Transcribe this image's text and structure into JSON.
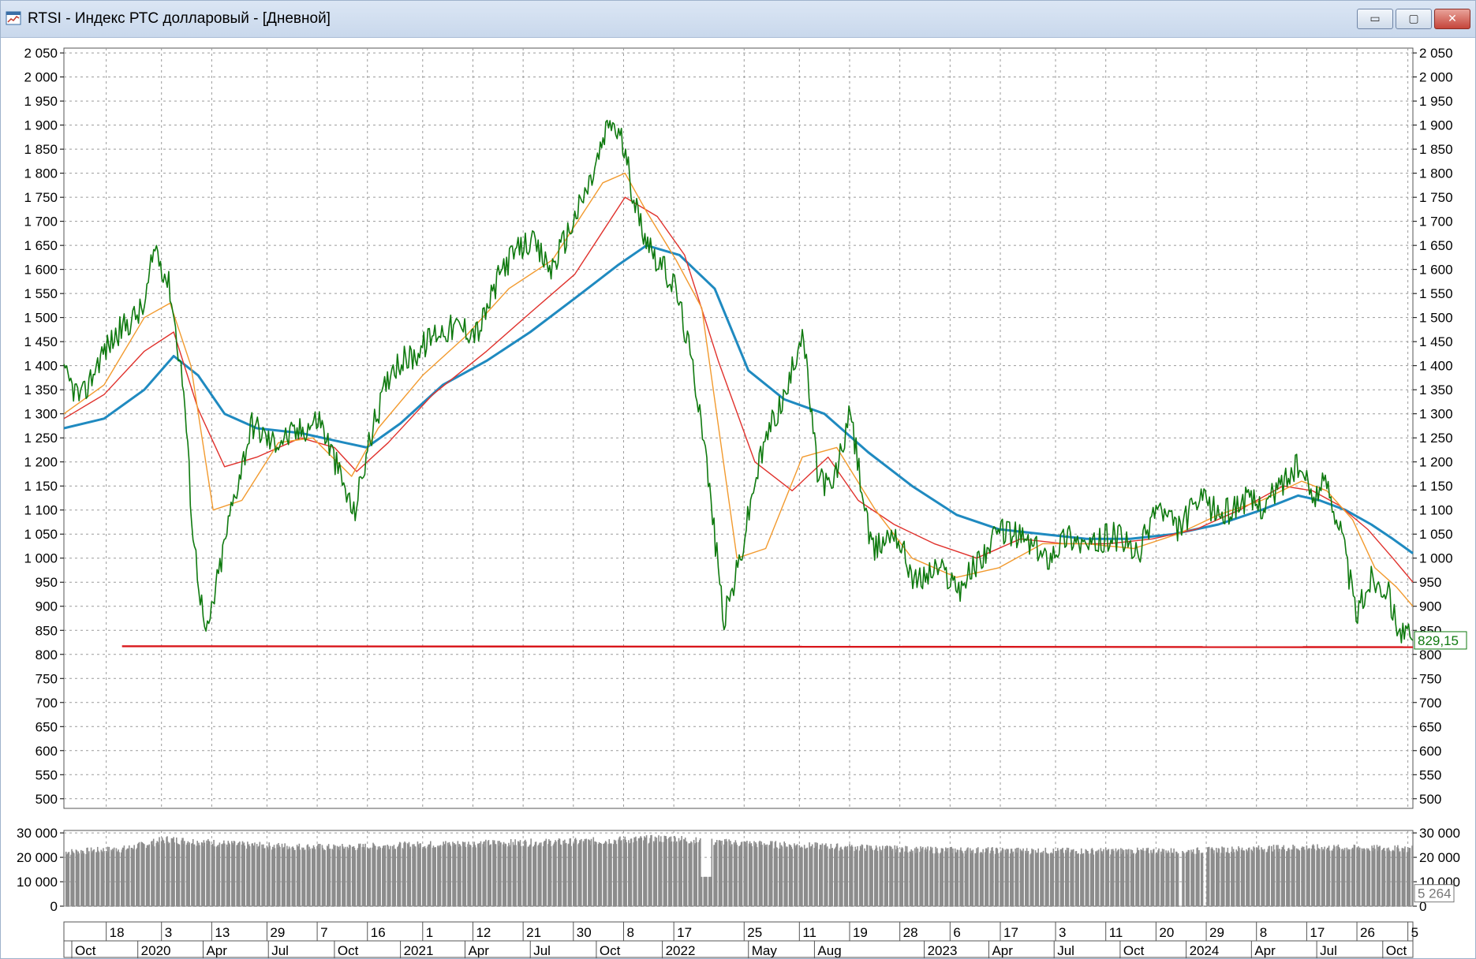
{
  "window": {
    "title": "RTSI - Индекс РТС долларовый - [Дневной]",
    "minimize_glyph": "▭",
    "maximize_glyph": "▢",
    "close_glyph": "✕",
    "icon": "chart-window-icon"
  },
  "colors": {
    "price": "#0f7a0f",
    "ma_short": "#f29a2e",
    "ma_mid": "#e0312c",
    "ma_long": "#1f8ac0",
    "support": "#d9161b",
    "volume": "#8c8c8c",
    "grid": "#9a9a9a"
  },
  "chart_data": [
    {
      "type": "line",
      "y_ticks": [
        "2 050",
        "2 000",
        "1 950",
        "1 900",
        "1 850",
        "1 800",
        "1 750",
        "1 700",
        "1 650",
        "1 600",
        "1 550",
        "1 500",
        "1 450",
        "1 400",
        "1 350",
        "1 300",
        "1 250",
        "1 200",
        "1 150",
        "1 100",
        "1 050",
        "1 000",
        "950",
        "900",
        "850",
        "800",
        "750",
        "700",
        "650",
        "600",
        "550",
        "500"
      ],
      "ylim": [
        480,
        2060
      ],
      "xlim": [
        "2019-09-20",
        "2024-11-12"
      ],
      "last_value_label": "829,15",
      "grid": true,
      "series": [
        {
          "role": "price",
          "x": [
            "2019-09-20",
            "2019-10-15",
            "2019-11-10",
            "2019-12-05",
            "2020-01-10",
            "2020-01-25",
            "2020-02-15",
            "2020-03-05",
            "2020-03-18",
            "2020-04-05",
            "2020-05-10",
            "2020-06-08",
            "2020-07-05",
            "2020-08-10",
            "2020-09-10",
            "2020-10-02",
            "2020-10-28",
            "2020-11-20",
            "2020-12-20",
            "2021-01-20",
            "2021-02-20",
            "2021-03-20",
            "2021-04-20",
            "2021-05-25",
            "2021-06-30",
            "2021-07-30",
            "2021-08-30",
            "2021-09-25",
            "2021-10-20",
            "2021-11-05",
            "2021-11-30",
            "2021-12-25",
            "2022-01-20",
            "2022-02-05",
            "2022-02-24",
            "2022-03-28",
            "2022-04-20",
            "2022-05-10",
            "2022-05-30",
            "2022-06-25",
            "2022-07-15",
            "2022-08-05",
            "2022-08-25",
            "2022-09-20",
            "2022-10-20",
            "2022-11-20",
            "2022-12-20",
            "2023-01-20",
            "2023-02-20",
            "2023-03-20",
            "2023-04-20",
            "2023-05-20",
            "2023-06-20",
            "2023-07-20",
            "2023-08-20",
            "2023-09-20",
            "2023-10-10",
            "2023-10-25",
            "2023-11-20",
            "2023-12-20",
            "2024-01-20",
            "2024-02-20",
            "2024-03-20",
            "2024-04-20",
            "2024-05-15",
            "2024-06-05",
            "2024-06-25",
            "2024-07-15",
            "2024-08-05",
            "2024-08-25",
            "2024-09-15",
            "2024-10-05",
            "2024-10-25",
            "2024-11-12"
          ],
          "values": [
            1380,
            1330,
            1420,
            1470,
            1520,
            1650,
            1560,
            1350,
            1050,
            830,
            1100,
            1280,
            1240,
            1260,
            1290,
            1200,
            1090,
            1250,
            1400,
            1420,
            1470,
            1480,
            1470,
            1610,
            1660,
            1600,
            1700,
            1790,
            1910,
            1870,
            1700,
            1620,
            1560,
            1450,
            1300,
            870,
            1000,
            1160,
            1270,
            1350,
            1480,
            1180,
            1140,
            1300,
            1010,
            1060,
            950,
            980,
            940,
            1000,
            1060,
            1040,
            1000,
            1050,
            1020,
            1050,
            1030,
            1000,
            1110,
            1060,
            1120,
            1090,
            1120,
            1110,
            1160,
            1190,
            1130,
            1160,
            1050,
            880,
            960,
            940,
            850,
            829
          ]
        },
        {
          "role": "ma-short",
          "x": [
            "2019-09-20",
            "2019-11-15",
            "2020-01-10",
            "2020-02-15",
            "2020-03-15",
            "2020-04-15",
            "2020-05-25",
            "2020-07-15",
            "2020-09-01",
            "2020-10-25",
            "2020-12-01",
            "2021-02-01",
            "2021-04-01",
            "2021-06-01",
            "2021-08-01",
            "2021-10-10",
            "2021-11-10",
            "2021-12-10",
            "2022-01-20",
            "2022-02-25",
            "2022-04-15",
            "2022-05-25",
            "2022-07-15",
            "2022-09-01",
            "2022-10-25",
            "2022-12-15",
            "2023-02-15",
            "2023-04-15",
            "2023-06-15",
            "2023-08-15",
            "2023-10-20",
            "2023-12-20",
            "2024-02-15",
            "2024-04-15",
            "2024-06-10",
            "2024-07-15",
            "2024-08-20",
            "2024-09-20",
            "2024-10-20",
            "2024-11-12"
          ],
          "values": [
            1300,
            1360,
            1500,
            1530,
            1400,
            1100,
            1120,
            1240,
            1250,
            1170,
            1270,
            1380,
            1460,
            1560,
            1620,
            1780,
            1800,
            1720,
            1620,
            1520,
            1000,
            1020,
            1210,
            1230,
            1100,
            1000,
            960,
            980,
            1030,
            1030,
            1020,
            1050,
            1090,
            1120,
            1160,
            1140,
            1080,
            980,
            940,
            900
          ]
        },
        {
          "role": "ma-mid",
          "x": [
            "2019-09-20",
            "2019-11-15",
            "2020-01-10",
            "2020-02-20",
            "2020-03-25",
            "2020-05-01",
            "2020-06-15",
            "2020-08-15",
            "2020-10-01",
            "2020-11-01",
            "2020-12-15",
            "2021-02-15",
            "2021-05-01",
            "2021-07-01",
            "2021-09-01",
            "2021-11-10",
            "2021-12-25",
            "2022-02-01",
            "2022-03-20",
            "2022-05-10",
            "2022-07-01",
            "2022-08-20",
            "2022-10-01",
            "2022-11-20",
            "2023-01-15",
            "2023-03-15",
            "2023-05-15",
            "2023-07-15",
            "2023-09-15",
            "2023-11-15",
            "2024-01-15",
            "2024-03-15",
            "2024-05-15",
            "2024-06-25",
            "2024-08-01",
            "2024-09-10",
            "2024-10-15",
            "2024-11-12"
          ],
          "values": [
            1290,
            1340,
            1430,
            1470,
            1310,
            1190,
            1210,
            1250,
            1230,
            1180,
            1240,
            1340,
            1430,
            1510,
            1590,
            1750,
            1710,
            1630,
            1410,
            1200,
            1140,
            1210,
            1120,
            1070,
            1030,
            1000,
            1040,
            1030,
            1030,
            1040,
            1060,
            1100,
            1150,
            1140,
            1110,
            1060,
            1000,
            950
          ]
        },
        {
          "role": "ma-long",
          "x": [
            "2019-09-20",
            "2019-11-15",
            "2020-01-10",
            "2020-02-20",
            "2020-03-25",
            "2020-05-01",
            "2020-06-15",
            "2020-08-15",
            "2020-10-15",
            "2020-11-15",
            "2021-01-01",
            "2021-03-01",
            "2021-05-01",
            "2021-07-01",
            "2021-09-01",
            "2021-11-01",
            "2021-12-10",
            "2022-01-25",
            "2022-03-15",
            "2022-05-01",
            "2022-06-20",
            "2022-08-15",
            "2022-10-15",
            "2022-12-15",
            "2023-02-15",
            "2023-04-15",
            "2023-06-15",
            "2023-08-15",
            "2023-10-15",
            "2023-12-15",
            "2024-02-15",
            "2024-04-15",
            "2024-06-05",
            "2024-07-05",
            "2024-08-10",
            "2024-09-15",
            "2024-10-15",
            "2024-11-12"
          ],
          "values": [
            1270,
            1290,
            1350,
            1420,
            1380,
            1300,
            1270,
            1260,
            1240,
            1230,
            1280,
            1360,
            1410,
            1470,
            1540,
            1610,
            1650,
            1630,
            1560,
            1390,
            1330,
            1300,
            1220,
            1150,
            1090,
            1060,
            1050,
            1040,
            1040,
            1050,
            1070,
            1100,
            1130,
            1120,
            1100,
            1070,
            1040,
            1010
          ]
        },
        {
          "role": "support",
          "x": [
            "2019-12-10",
            "2024-11-12"
          ],
          "values": [
            817,
            815
          ]
        }
      ]
    },
    {
      "type": "bar",
      "y_ticks": [
        "30 000",
        "20 000",
        "10 000",
        "0"
      ],
      "ylim": [
        0,
        31000
      ],
      "last_value_label": "5 264",
      "profile_x": [
        "2019-09-20",
        "2019-12-15",
        "2020-02-10",
        "2020-06-01",
        "2020-10-01",
        "2021-03-01",
        "2021-09-01",
        "2022-01-15",
        "2022-03-01",
        "2022-07-01",
        "2023-01-01",
        "2023-07-01",
        "2024-01-01",
        "2024-06-01",
        "2024-11-01"
      ],
      "profile_values": [
        23500,
        25000,
        29000,
        26500,
        25500,
        27000,
        28000,
        29500,
        28000,
        26500,
        24500,
        24000,
        24000,
        25500,
        25000
      ],
      "gaps": [
        {
          "from": "2022-02-24",
          "to": "2022-03-10",
          "value": 12000
        },
        {
          "from": "2023-12-22",
          "to": "2023-12-26",
          "value": 0
        },
        {
          "from": "2024-01-25",
          "to": "2024-01-29",
          "value": 0
        }
      ]
    }
  ],
  "x_axis": {
    "top_labels": [
      {
        "date": "2019-11-18",
        "text": "18"
      },
      {
        "date": "2020-02-03",
        "text": "3"
      },
      {
        "date": "2020-04-13",
        "text": "13"
      },
      {
        "date": "2020-06-29",
        "text": "29"
      },
      {
        "date": "2020-09-07",
        "text": "7"
      },
      {
        "date": "2020-11-16",
        "text": "16"
      },
      {
        "date": "2021-02-01",
        "text": "1"
      },
      {
        "date": "2021-04-12",
        "text": "12"
      },
      {
        "date": "2021-06-21",
        "text": "21"
      },
      {
        "date": "2021-08-30",
        "text": "30"
      },
      {
        "date": "2021-11-08",
        "text": "8"
      },
      {
        "date": "2022-01-17",
        "text": "17"
      },
      {
        "date": "2022-04-25",
        "text": "25"
      },
      {
        "date": "2022-07-11",
        "text": "11"
      },
      {
        "date": "2022-09-19",
        "text": "19"
      },
      {
        "date": "2022-11-28",
        "text": "28"
      },
      {
        "date": "2023-02-06",
        "text": "6"
      },
      {
        "date": "2023-04-17",
        "text": "17"
      },
      {
        "date": "2023-07-03",
        "text": "3"
      },
      {
        "date": "2023-09-11",
        "text": "11"
      },
      {
        "date": "2023-11-20",
        "text": "20"
      },
      {
        "date": "2024-01-29",
        "text": "29"
      },
      {
        "date": "2024-04-08",
        "text": "8"
      },
      {
        "date": "2024-06-17",
        "text": "17"
      },
      {
        "date": "2024-08-26",
        "text": "26"
      },
      {
        "date": "2024-11-05",
        "text": "5"
      }
    ],
    "bottom_labels": [
      {
        "date": "2019-10-01",
        "text": "Oct"
      },
      {
        "date": "2020-01-01",
        "text": "2020"
      },
      {
        "date": "2020-04-01",
        "text": "Apr"
      },
      {
        "date": "2020-07-01",
        "text": "Jul"
      },
      {
        "date": "2020-10-01",
        "text": "Oct"
      },
      {
        "date": "2021-01-01",
        "text": "2021"
      },
      {
        "date": "2021-04-01",
        "text": "Apr"
      },
      {
        "date": "2021-07-01",
        "text": "Jul"
      },
      {
        "date": "2021-10-01",
        "text": "Oct"
      },
      {
        "date": "2022-01-01",
        "text": "2022"
      },
      {
        "date": "2022-05-01",
        "text": "May"
      },
      {
        "date": "2022-08-01",
        "text": "Aug"
      },
      {
        "date": "2023-01-01",
        "text": "2023"
      },
      {
        "date": "2023-04-01",
        "text": "Apr"
      },
      {
        "date": "2023-07-01",
        "text": "Jul"
      },
      {
        "date": "2023-10-01",
        "text": "Oct"
      },
      {
        "date": "2024-01-01",
        "text": "2024"
      },
      {
        "date": "2024-04-01",
        "text": "Apr"
      },
      {
        "date": "2024-07-01",
        "text": "Jul"
      },
      {
        "date": "2024-10-01",
        "text": "Oct"
      }
    ]
  }
}
